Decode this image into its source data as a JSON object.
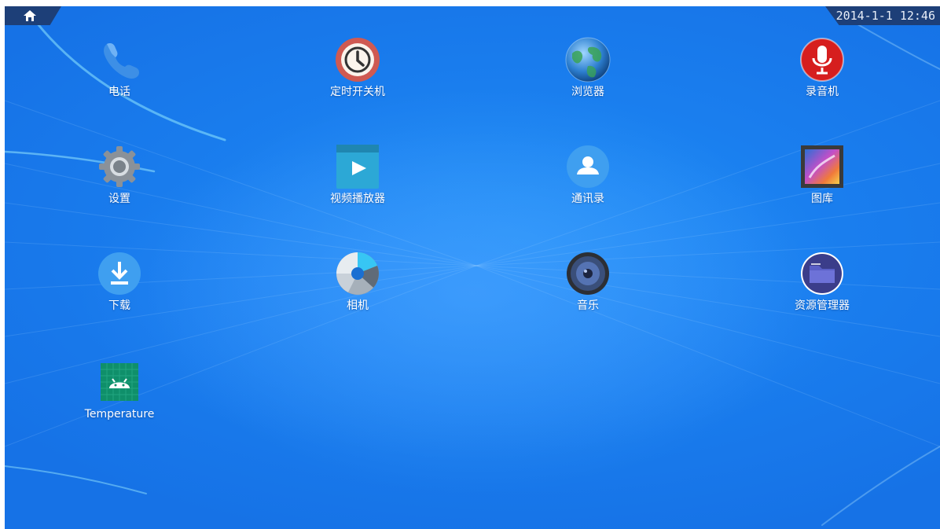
{
  "status_bar": {
    "home_icon": "home-icon",
    "datetime": "2014-1-1 12:46"
  },
  "colors": {
    "wallpaper": "#1a80f0",
    "status_tab": "#1d3f78",
    "label": "#ffffff"
  },
  "apps": [
    {
      "label": "电话",
      "icon": "phone-icon"
    },
    {
      "label": "定时开关机",
      "icon": "clock-icon"
    },
    {
      "label": "浏览器",
      "icon": "globe-icon"
    },
    {
      "label": "录音机",
      "icon": "microphone-icon"
    },
    {
      "label": "设置",
      "icon": "gear-icon"
    },
    {
      "label": "视频播放器",
      "icon": "video-player-icon"
    },
    {
      "label": "通讯录",
      "icon": "contacts-icon"
    },
    {
      "label": "图库",
      "icon": "gallery-icon"
    },
    {
      "label": "下载",
      "icon": "download-icon"
    },
    {
      "label": "相机",
      "icon": "camera-aperture-icon"
    },
    {
      "label": "音乐",
      "icon": "speaker-icon"
    },
    {
      "label": "资源管理器",
      "icon": "folder-icon"
    },
    {
      "label": "Temperature",
      "icon": "android-icon"
    }
  ]
}
